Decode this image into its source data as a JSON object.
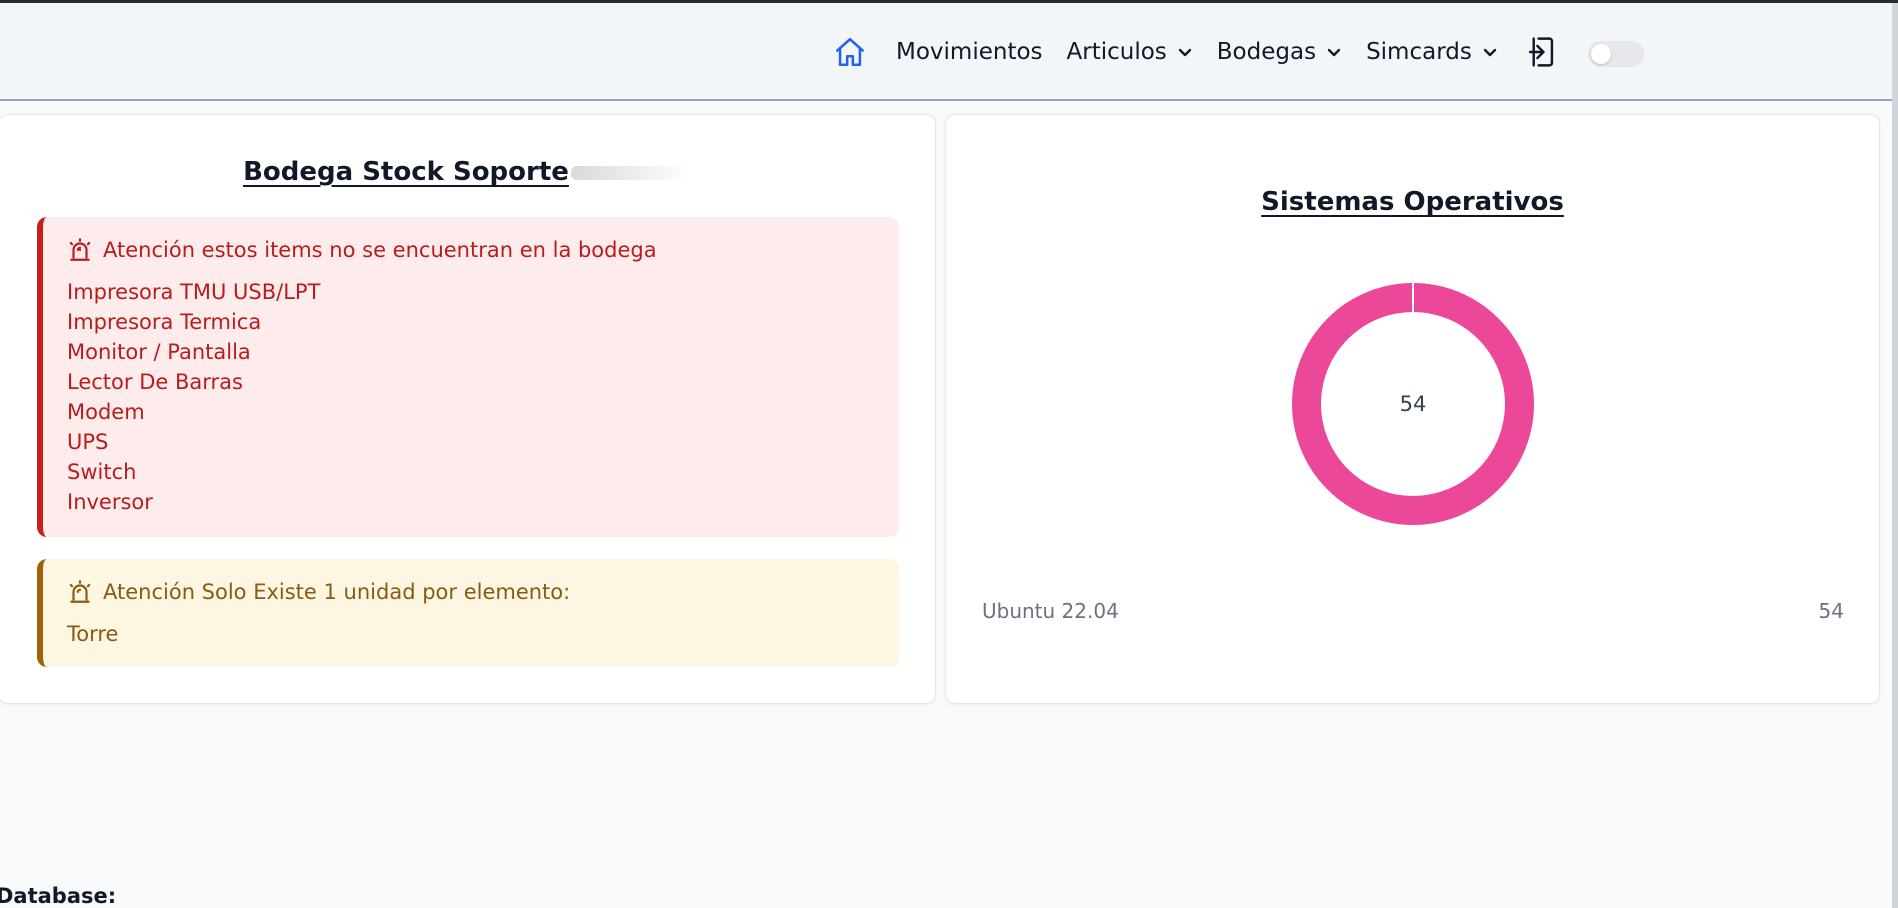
{
  "nav": {
    "items": [
      {
        "label": "Movimientos",
        "has_dropdown": false
      },
      {
        "label": "Articulos",
        "has_dropdown": true
      },
      {
        "label": "Bodegas",
        "has_dropdown": true
      },
      {
        "label": "Simcards",
        "has_dropdown": true
      }
    ],
    "home_icon": "home-icon",
    "logout_icon": "logout-icon",
    "toggle_state": "off",
    "accent_color": "#2563eb"
  },
  "stock_card": {
    "title": "Bodega Stock Soporte",
    "missing_alert": {
      "heading": "Atención estos items no se encuentran en la bodega",
      "icon": "siren-icon",
      "items": [
        "Impresora TMU USB/LPT",
        "Impresora Termica",
        "Monitor / Pantalla",
        "Lector De Barras",
        "Modem",
        "UPS",
        "Switch",
        "Inversor"
      ],
      "color": "#b91c1c"
    },
    "single_alert": {
      "heading": "Atención Solo Existe 1 unidad por elemento:",
      "icon": "siren-icon",
      "items": [
        "Torre"
      ],
      "color": "#8a5a0e"
    }
  },
  "os_card": {
    "title": "Sistemas Operativos",
    "center_label": "54"
  },
  "chart_data": {
    "type": "pie",
    "title": "Sistemas Operativos",
    "categories": [
      "Ubuntu 22.04"
    ],
    "values": [
      54
    ],
    "colors": [
      "#ec4899"
    ],
    "legend": [
      {
        "name": "Ubuntu 22.04",
        "value": "54"
      }
    ],
    "legend_position": "bottom"
  },
  "footer": {
    "database_label": "Database:"
  }
}
